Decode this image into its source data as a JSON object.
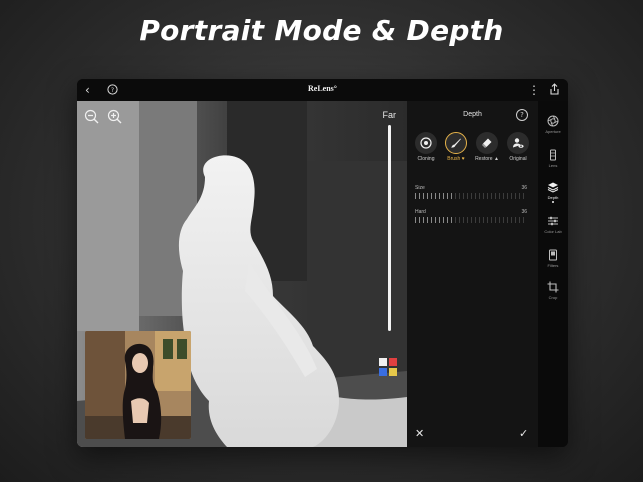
{
  "headline": "Portrait Mode & Depth",
  "app": {
    "brand": "ReLens°"
  },
  "canvas": {
    "depth_label": "Far"
  },
  "panel": {
    "title": "Depth",
    "tools": [
      {
        "label": "Cloning",
        "icon": "target-icon"
      },
      {
        "label": "Brush ♥",
        "icon": "brush-icon",
        "active": true
      },
      {
        "label": "Restore ▲",
        "icon": "eraser-icon"
      },
      {
        "label": "Original",
        "icon": "person-eye-icon"
      }
    ],
    "sliders": [
      {
        "name": "Size",
        "value": "36",
        "level": 36
      },
      {
        "name": "Hard",
        "value": "36",
        "level": 36
      }
    ]
  },
  "rail": [
    {
      "label": "Aperture",
      "icon": "aperture-icon"
    },
    {
      "label": "Lens",
      "icon": "lens-icon"
    },
    {
      "label": "Depth",
      "icon": "layers-icon",
      "active": true
    },
    {
      "label": "Color Lab",
      "icon": "sliders-icon"
    },
    {
      "label": "Filters",
      "icon": "filter-icon"
    },
    {
      "label": "Crop",
      "icon": "crop-icon"
    }
  ],
  "colors": {
    "accent": "#e6b34a",
    "panel": "#141414"
  }
}
